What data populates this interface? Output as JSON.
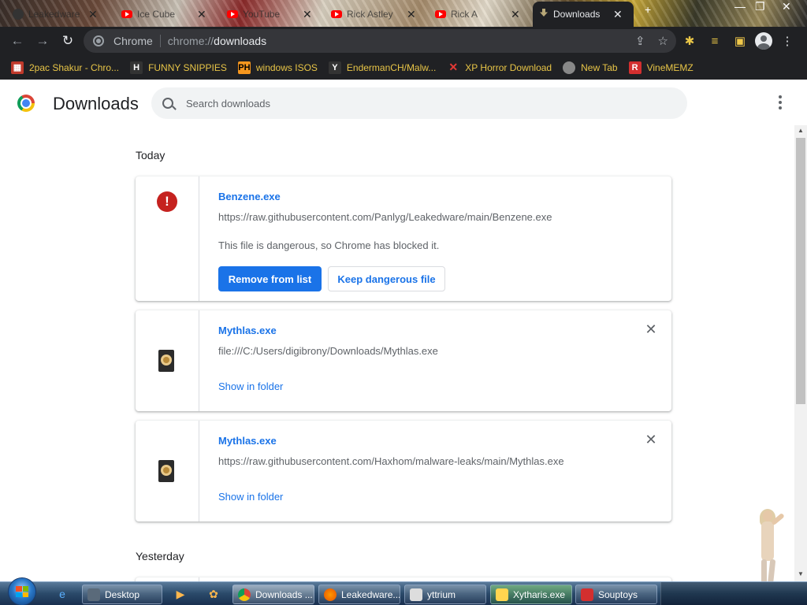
{
  "tabs": [
    {
      "title": "Leakedware",
      "icon": "github-icon"
    },
    {
      "title": "Ice Cube",
      "icon": "youtube-icon"
    },
    {
      "title": "YouTube",
      "icon": "youtube-icon"
    },
    {
      "title": "Rick Astley",
      "icon": "youtube-icon"
    },
    {
      "title": "Rick A",
      "icon": "youtube-icon"
    },
    {
      "title": "Downloads",
      "icon": "download-icon"
    }
  ],
  "omnibox": {
    "site": "Chrome",
    "scheme": "chrome://",
    "path": "downloads"
  },
  "bookmarks": [
    {
      "label": "2pac Shakur - Chro...",
      "icon": "image-icon",
      "color": "#c0392b"
    },
    {
      "label": "FUNNY SNIPPIES",
      "icon": "h-icon",
      "color": "#333333"
    },
    {
      "label": "windows ISOS",
      "icon": "ph-icon",
      "color": "#f7971e"
    },
    {
      "label": "EndermanCH/Malw...",
      "icon": "yp-icon",
      "color": "#333333"
    },
    {
      "label": "XP Horror Download",
      "icon": "x-icon",
      "color": "#e53935"
    },
    {
      "label": "New Tab",
      "icon": "globe-icon",
      "color": "#888888"
    },
    {
      "label": "VineMEMZ",
      "icon": "r-icon",
      "color": "#d32f2f"
    }
  ],
  "page": {
    "title": "Downloads",
    "search_placeholder": "Search downloads",
    "sections": [
      {
        "label": "Today"
      },
      {
        "label": "Yesterday"
      }
    ],
    "items": [
      {
        "name": "Benzene.exe",
        "url": "https://raw.githubusercontent.com/Panlyg/Leakedware/main/Benzene.exe",
        "warning": "This file is dangerous, so Chrome has blocked it.",
        "remove_label": "Remove from list",
        "keep_label": "Keep dangerous file"
      },
      {
        "name": "Mythlas.exe",
        "url": "file:///C:/Users/digibrony/Downloads/Mythlas.exe",
        "action": "Show in folder"
      },
      {
        "name": "Mythlas.exe",
        "url": "https://raw.githubusercontent.com/Haxhom/malware-leaks/main/Mythlas.exe",
        "action": "Show in folder"
      }
    ]
  },
  "taskbar": {
    "items": [
      {
        "label": "Desktop",
        "icon": "desktop-icon"
      },
      {
        "label": "Downloads ...",
        "icon": "chrome-icon"
      },
      {
        "label": "Leakedware...",
        "icon": "firefox-icon"
      },
      {
        "label": "yttrium",
        "icon": "app-icon"
      },
      {
        "label": "Xytharis.exe",
        "icon": "app-icon"
      },
      {
        "label": "Souptoys",
        "icon": "souptoys-icon"
      }
    ]
  },
  "colors": {
    "accent": "#1a73e8",
    "danger": "#c5221f",
    "bookmark_text": "#e8c547"
  }
}
